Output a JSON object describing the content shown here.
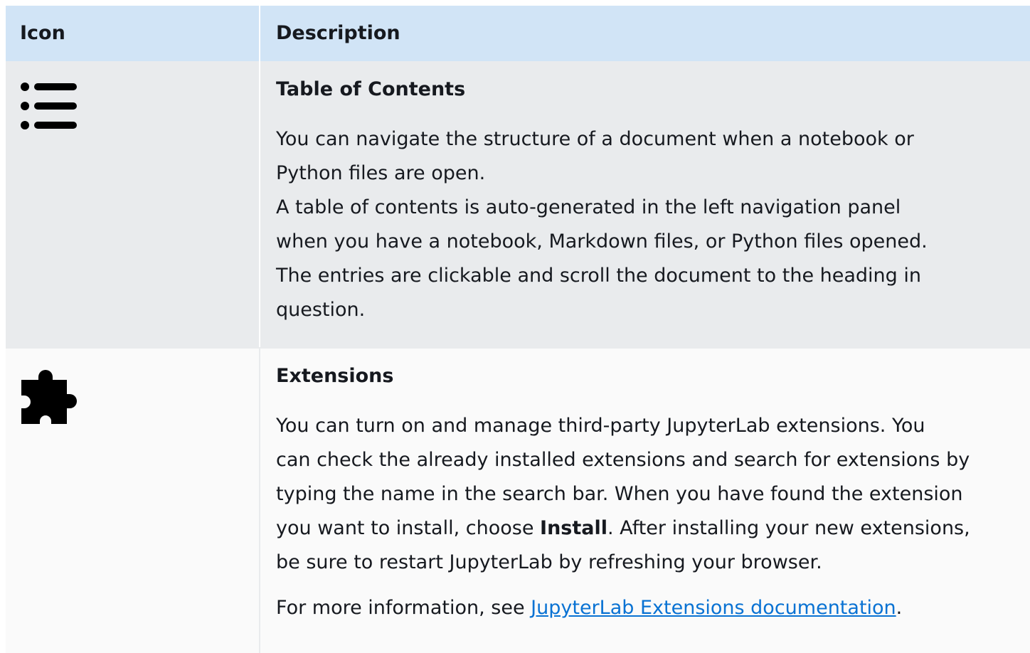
{
  "table": {
    "headers": {
      "icon": "Icon",
      "description": "Description"
    },
    "rows": [
      {
        "icon": "list-icon",
        "title": "Table of Contents",
        "lines": [
          "You can navigate the structure of a document when a notebook or",
          "Python files are open.",
          "A table of contents is auto-generated in the left navigation panel",
          "when you have a notebook, Markdown files, or Python files opened.",
          "The entries are clickable and scroll the document to the heading in",
          "question."
        ]
      },
      {
        "icon": "puzzle-piece-icon",
        "title": "Extensions",
        "para1": {
          "lines": [
            "You can turn on and manage third-party JupyterLab extensions. You",
            "can check the already installed extensions and search for extensions by",
            "typing the name in the search bar. When you have found the extension"
          ],
          "line4_before": "you want to install, choose ",
          "line4_bold": "Install",
          "line4_after": ". After installing your new extensions,",
          "line5": "be sure to restart JupyterLab by refreshing your browser."
        },
        "para2": {
          "before": "For more information, see ",
          "link": "JupyterLab Extensions documentation",
          "after": "."
        }
      }
    ]
  },
  "colors": {
    "header_bg": "#d1e4f6",
    "row1_bg": "#e9ebed",
    "row2_bg": "#fafafa",
    "link": "#0972d3"
  }
}
